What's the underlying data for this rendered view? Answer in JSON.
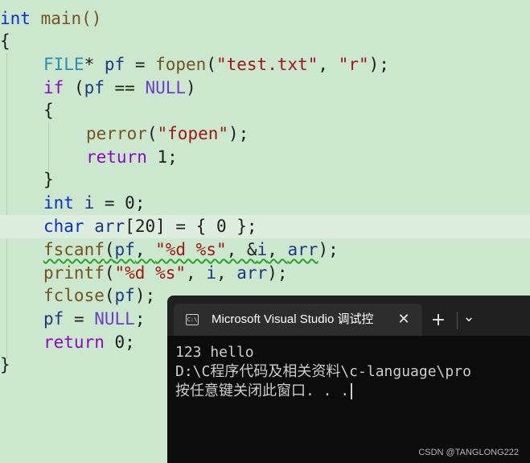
{
  "code": {
    "l1": {
      "a": "int",
      "b": " main()"
    },
    "l2": "{",
    "l3": {
      "a": "FILE",
      "b": "* ",
      "c": "pf",
      "d": " = ",
      "e": "fopen",
      "f": "(",
      "g": "\"test.txt\"",
      "h": ", ",
      "i": "\"r\"",
      "j": ");"
    },
    "l4": {
      "a": "if",
      "b": " (",
      "c": "pf",
      "d": " == ",
      "e": "NULL",
      "f": ")"
    },
    "l5": "{",
    "l6": {
      "a": "perror",
      "b": "(",
      "c": "\"fopen\"",
      "d": ");"
    },
    "l7": {
      "a": "return",
      "b": " 1;"
    },
    "l8": "}",
    "l9": {
      "a": "int",
      "b": " ",
      "c": "i",
      "d": " = 0;"
    },
    "l10": {
      "a": "char",
      "b": " ",
      "c": "arr",
      "d": "[20] = { 0 };"
    },
    "l11": {
      "a": "fscanf",
      "b": "(",
      "c": "pf",
      "d": ", ",
      "e": "\"%d %s\"",
      "f": ", &",
      "g": "i",
      "h": ", ",
      "i": "arr",
      "j": ");"
    },
    "l12": {
      "a": "printf",
      "b": "(",
      "c": "\"%d %s\"",
      "d": ", ",
      "e": "i",
      "f": ", ",
      "g": "arr",
      "h": ");"
    },
    "l13": {
      "a": "fclose",
      "b": "(",
      "c": "pf",
      "d": ");"
    },
    "l14": {
      "a": "pf",
      "b": " = ",
      "c": "NULL",
      "d": ";"
    },
    "l15": {
      "a": "return",
      "b": " 0;"
    },
    "l16": "}"
  },
  "console": {
    "tab_icon": "C:\\",
    "tab_title": "Microsoft Visual Studio 调试控",
    "close_glyph": "✕",
    "new_tab_glyph": "+",
    "dropdown_glyph": "⌄",
    "output": [
      "123 hello",
      "D:\\C程序代码及相关资料\\c-language\\pro",
      "按任意键关闭此窗口. . ."
    ]
  },
  "watermark": "CSDN @TANGLONG222"
}
